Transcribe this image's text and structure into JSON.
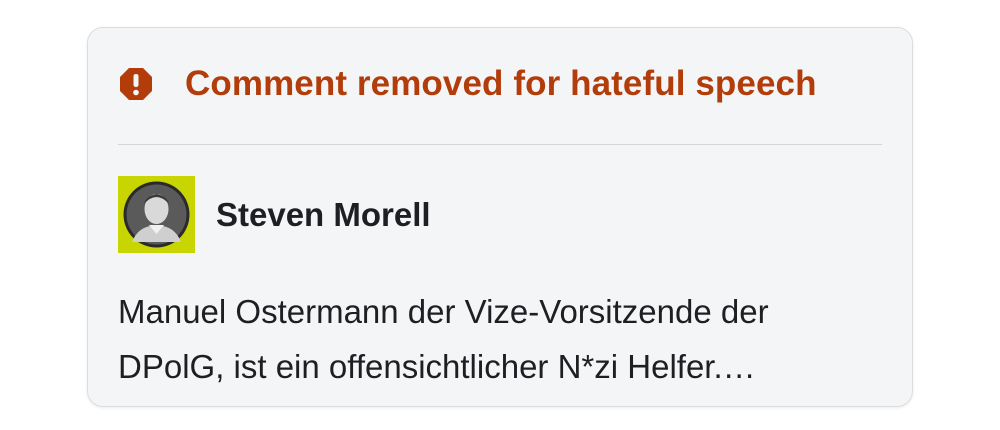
{
  "card": {
    "removal_notice": {
      "icon": "alert-octagon-icon",
      "text": "Comment removed for hateful speech",
      "color": "#b23d0b"
    },
    "author": {
      "name": "Steven Morell",
      "avatar_icon": "user-avatar-photo",
      "avatar_bg_color": "#c9d500"
    },
    "comment": {
      "lines": [
        "Manuel Ostermann der Vize-Vorsitzende der",
        "DPolG, ist ein offensichtlicher N*zi Helfer.…"
      ]
    }
  }
}
